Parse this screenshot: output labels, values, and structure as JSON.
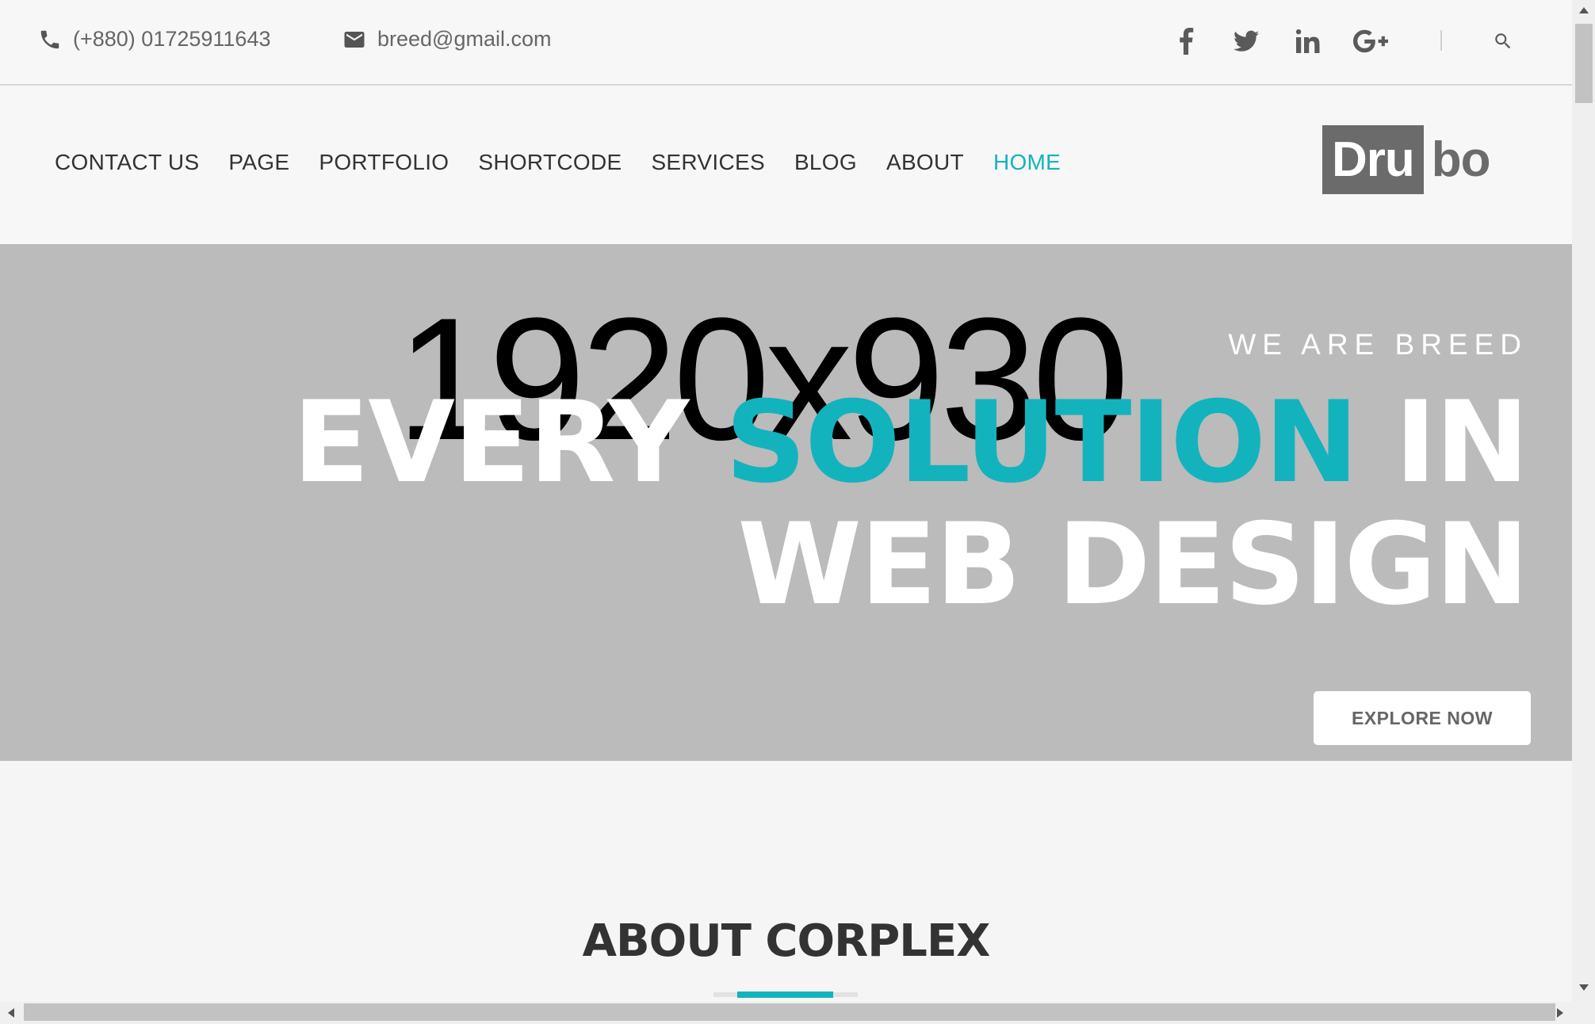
{
  "topbar": {
    "phone": "(+880) 01725911643",
    "email": "breed@gmail.com",
    "social": [
      "facebook-icon",
      "twitter-icon",
      "linkedin-icon",
      "google-plus-icon"
    ],
    "search_icon": "search-icon"
  },
  "nav": {
    "items": [
      "CONTACT US",
      "PAGE",
      "PORTFOLIO",
      "SHORTCODE",
      "SERVICES",
      "BLOG",
      "ABOUT",
      "HOME"
    ],
    "active": "HOME"
  },
  "logo": {
    "part1": "Dru",
    "part2": "bo"
  },
  "hero": {
    "placeholder": "1920x930",
    "kicker": "WE ARE BREED",
    "line1_a": "EVERY ",
    "line1_accent": "SOLUTION",
    "line1_b": " IN",
    "line2": "WEB DESIGN",
    "button": "EXPLORE NOW"
  },
  "about": {
    "title": "ABOUT CORPLEX"
  },
  "colors": {
    "accent": "#13b3bd",
    "hero_bg": "#bbbbbb"
  }
}
